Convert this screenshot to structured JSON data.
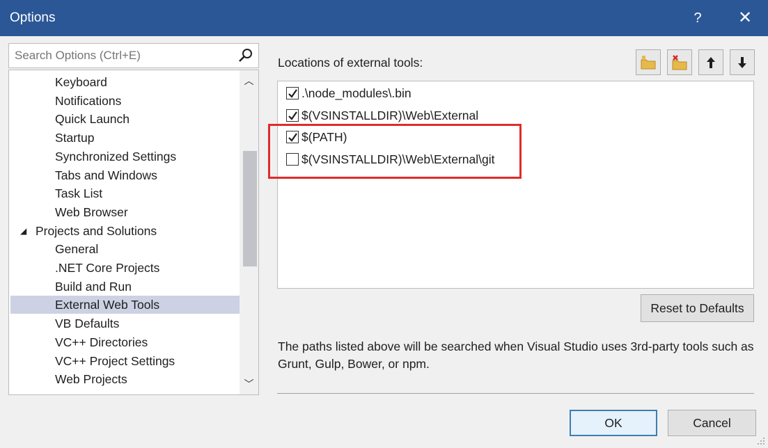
{
  "window": {
    "title": "Options",
    "help_label": "?",
    "close_label": "✕"
  },
  "search": {
    "placeholder": "Search Options (Ctrl+E)"
  },
  "tree": {
    "items": [
      {
        "label": "Keyboard",
        "level": "child"
      },
      {
        "label": "Notifications",
        "level": "child"
      },
      {
        "label": "Quick Launch",
        "level": "child"
      },
      {
        "label": "Startup",
        "level": "child"
      },
      {
        "label": "Synchronized Settings",
        "level": "child"
      },
      {
        "label": "Tabs and Windows",
        "level": "child"
      },
      {
        "label": "Task List",
        "level": "child"
      },
      {
        "label": "Web Browser",
        "level": "child"
      },
      {
        "label": "Projects and Solutions",
        "level": "parent",
        "expander": "◢"
      },
      {
        "label": "General",
        "level": "child"
      },
      {
        "label": ".NET Core Projects",
        "level": "child"
      },
      {
        "label": "Build and Run",
        "level": "child"
      },
      {
        "label": "External Web Tools",
        "level": "child",
        "selected": true
      },
      {
        "label": "VB Defaults",
        "level": "child"
      },
      {
        "label": "VC++ Directories",
        "level": "child"
      },
      {
        "label": "VC++ Project Settings",
        "level": "child"
      },
      {
        "label": "Web Projects",
        "level": "child"
      }
    ],
    "scroll_up": "︿",
    "scroll_down": "﹀"
  },
  "panel": {
    "section_label": "Locations of external tools:",
    "locations": [
      {
        "path": ".\\node_modules\\.bin",
        "checked": true
      },
      {
        "path": "$(VSINSTALLDIR)\\Web\\External",
        "checked": true
      },
      {
        "path": "$(PATH)",
        "checked": true
      },
      {
        "path": "$(VSINSTALLDIR)\\Web\\External\\git",
        "checked": false
      }
    ],
    "reset_label": "Reset to Defaults",
    "description": "The paths listed above will be searched when Visual Studio uses 3rd-party tools such as Grunt, Gulp, Bower, or npm."
  },
  "footer": {
    "ok_label": "OK",
    "cancel_label": "Cancel"
  },
  "colors": {
    "titlebar": "#2b5797",
    "selection": "#ccd2e3",
    "highlight": "#e02b2b"
  }
}
